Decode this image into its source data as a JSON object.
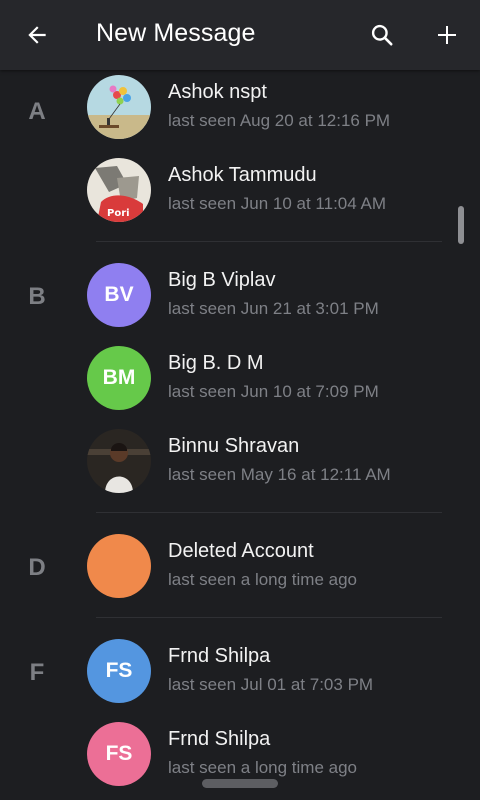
{
  "toolbar": {
    "title": "New Message",
    "back_icon": "arrow-left-icon",
    "search_icon": "search-icon",
    "add_icon": "plus-icon"
  },
  "sections": [
    {
      "letter": "A"
    },
    {
      "letter": "B"
    },
    {
      "letter": "D"
    },
    {
      "letter": "F"
    }
  ],
  "contacts": [
    {
      "name": "Ashok nspt",
      "status": "last seen Aug 20 at 12:16 PM",
      "avatar": "photo"
    },
    {
      "name": "Ashok Tammudu",
      "status": "last seen Jun 10 at 11:04 AM",
      "avatar": "photo"
    },
    {
      "name": "Big B Viplav",
      "status": "last seen Jun 21 at 3:01 PM",
      "initials": "BV",
      "color": "#8f7ff0"
    },
    {
      "name": "Big B. D M",
      "status": "last seen Jun 10 at 7:09 PM",
      "initials": "BM",
      "color": "#66c94a"
    },
    {
      "name": "Binnu Shravan",
      "status": "last seen May 16 at 12:11 AM",
      "avatar": "photo"
    },
    {
      "name": "Deleted Account",
      "status": "last seen a long time ago",
      "initials": "",
      "color": "#f0894b"
    },
    {
      "name": "Frnd Shilpa",
      "status": "last seen Jul 01 at 7:03 PM",
      "initials": "FS",
      "color": "#5496e0"
    },
    {
      "name": "Frnd Shilpa",
      "status": "last seen a long time ago",
      "initials": "FS",
      "color": "#ec6f96"
    }
  ]
}
